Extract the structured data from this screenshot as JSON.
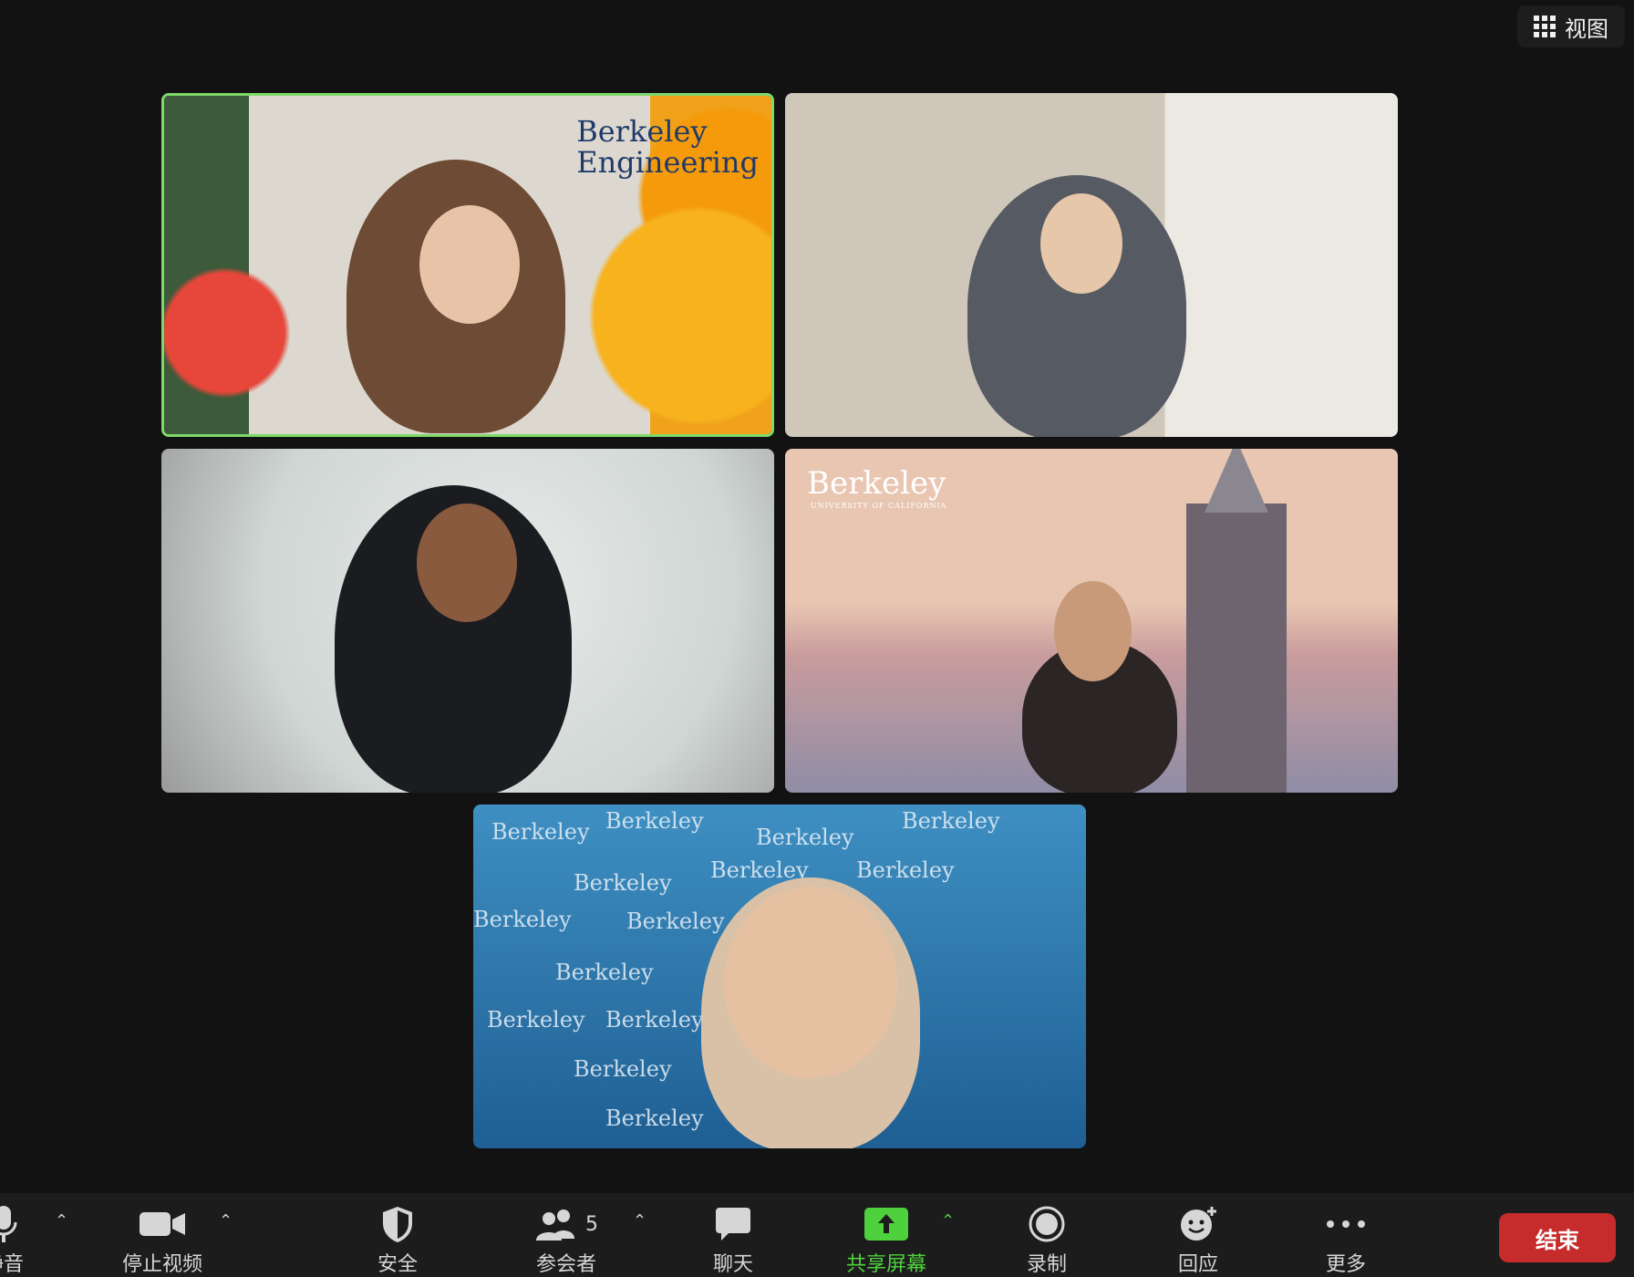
{
  "header": {
    "view_label": "视图"
  },
  "tiles": {
    "t1_logo_line1": "Berkeley",
    "t1_logo_line2": "Engineering",
    "t4_logo": "Berkeley",
    "t4_logo_sub": "UNIVERSITY OF CALIFORNIA",
    "t5_pattern_word": "Berkeley"
  },
  "toolbar": {
    "mute_label": "静音",
    "video_label": "停止视频",
    "security_label": "安全",
    "participants_label": "参会者",
    "participants_count": "5",
    "chat_label": "聊天",
    "share_label": "共享屏幕",
    "record_label": "录制",
    "reactions_label": "回应",
    "more_label": "更多",
    "end_label": "结束"
  },
  "colors": {
    "active_speaker_border": "#7ed96a",
    "share_green": "#4fd13d",
    "end_red": "#c72c2c"
  }
}
